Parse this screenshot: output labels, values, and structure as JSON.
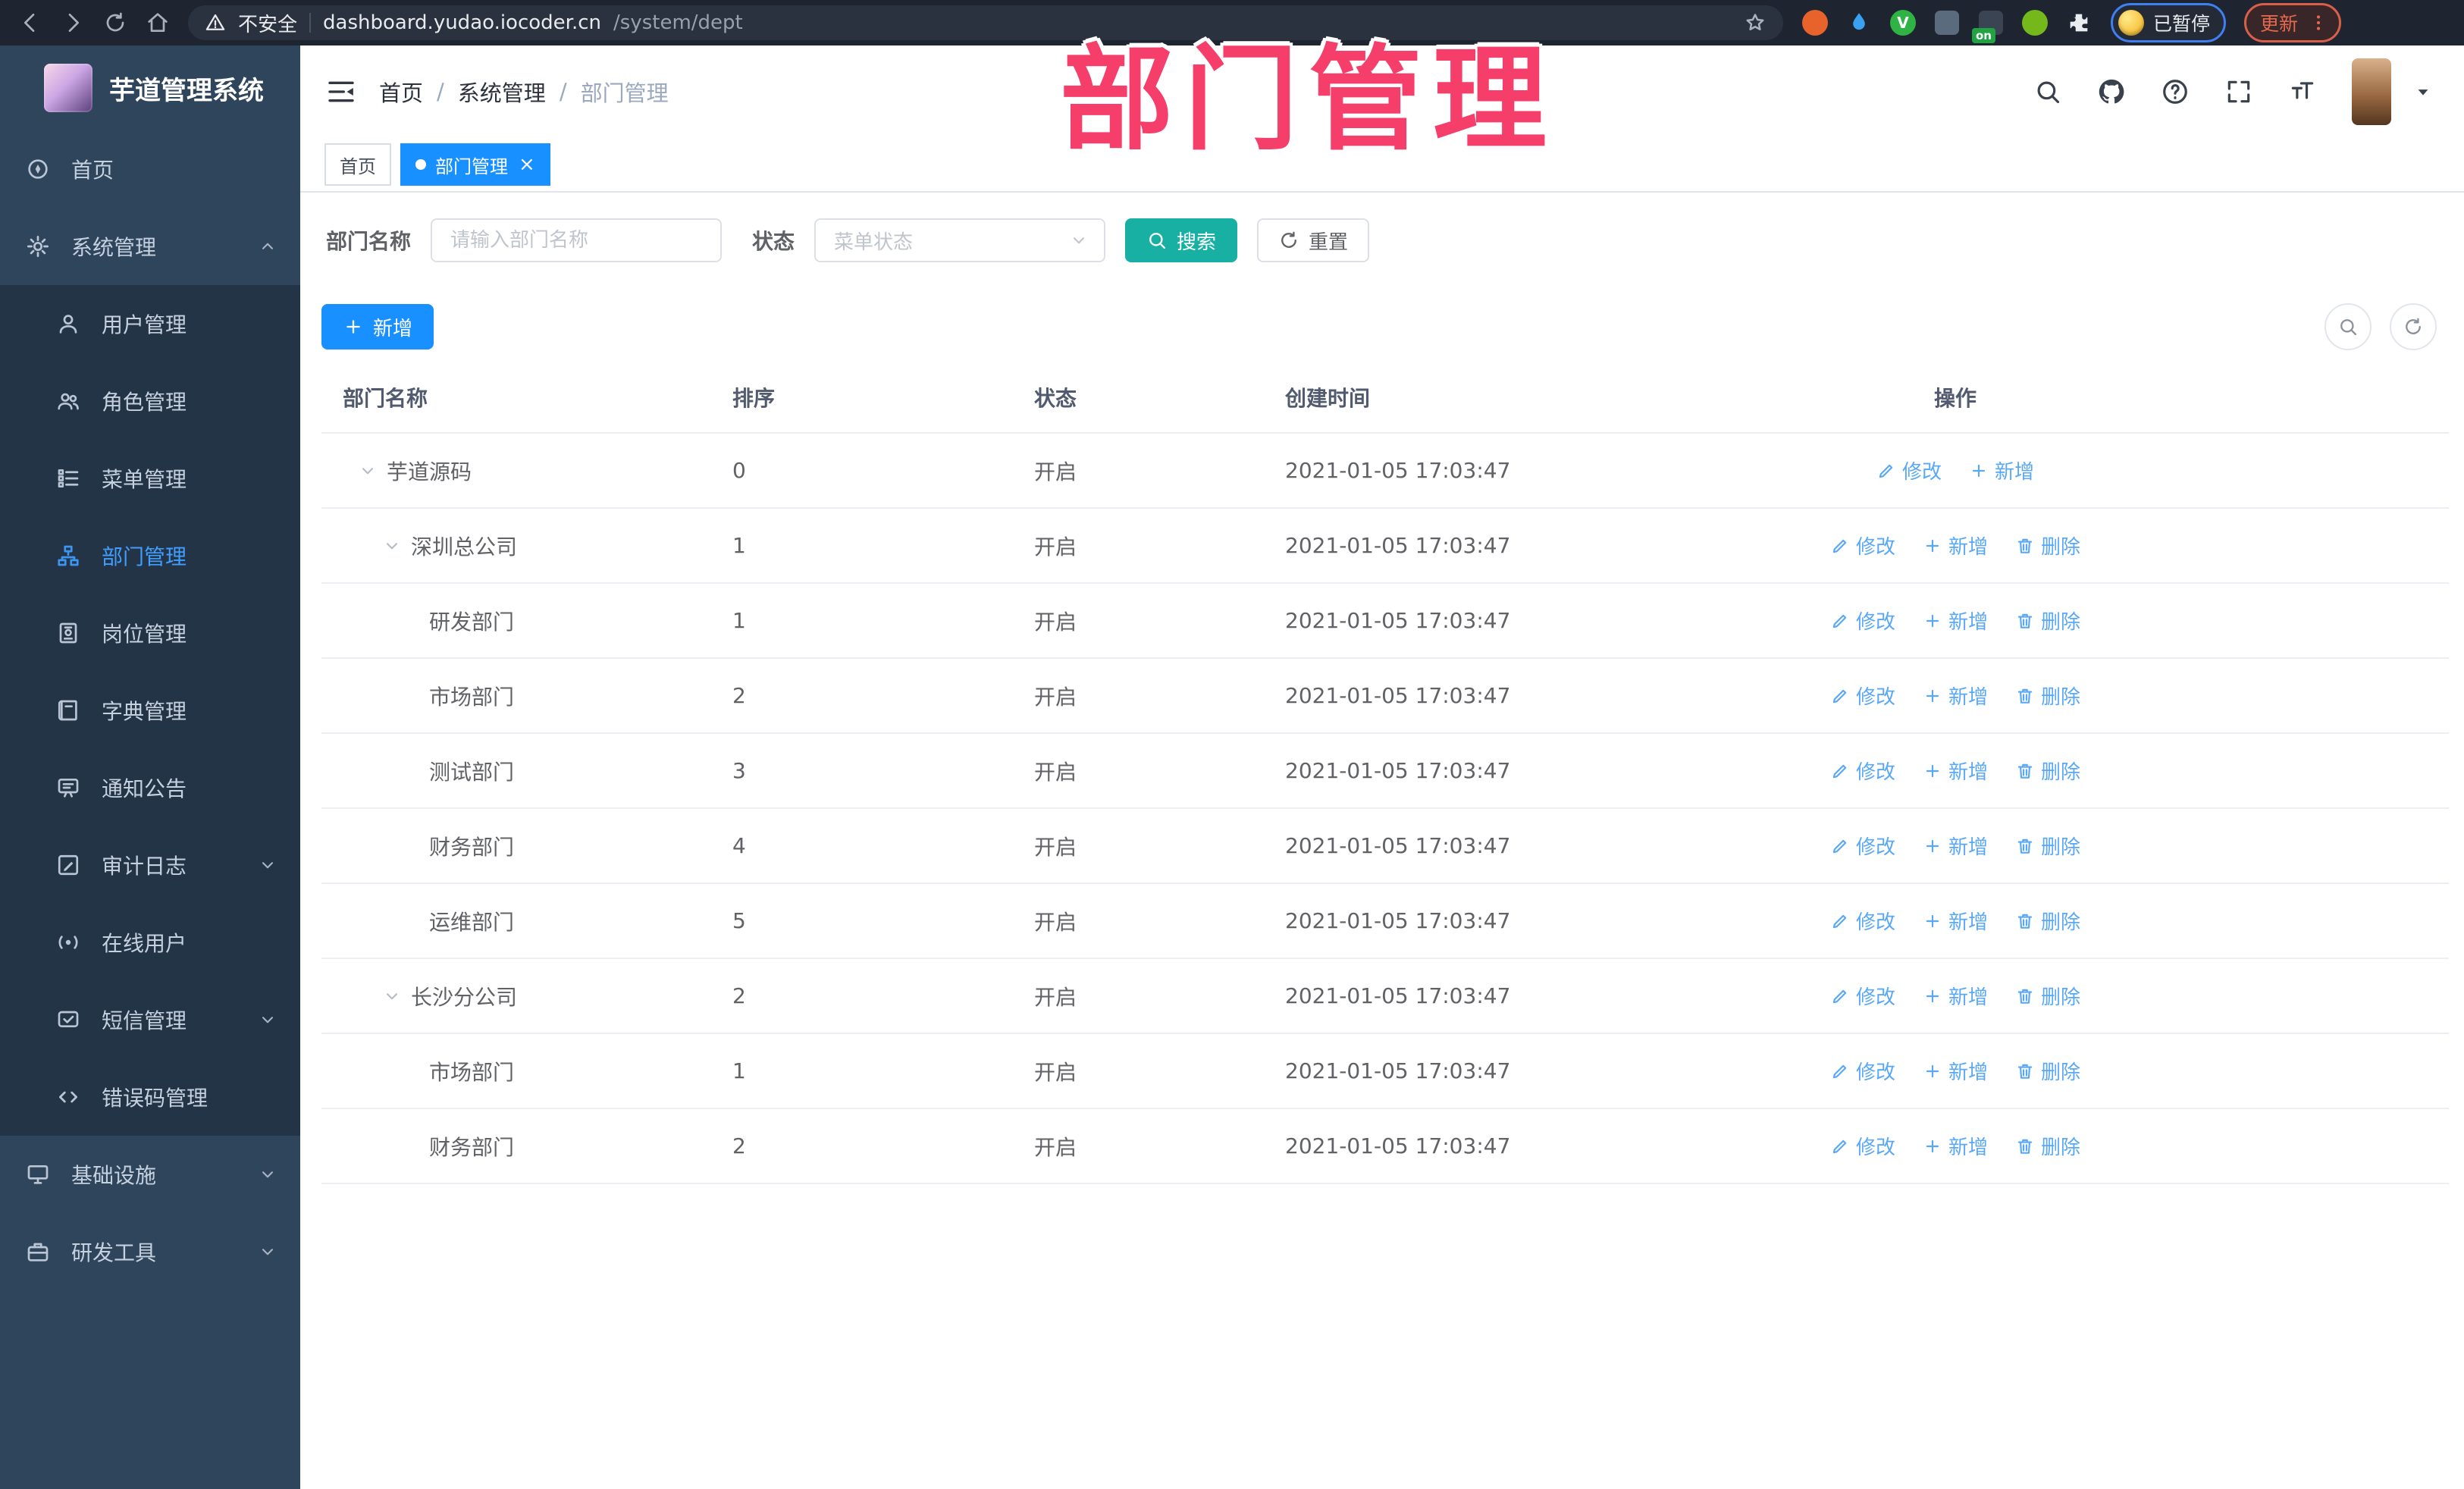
{
  "colors": {
    "accent": "#1890ff",
    "search-btn": "#17b0a3",
    "link": "#59a8f8",
    "sidebar-bg": "#2f455c",
    "submenu-bg": "#233447",
    "sidebar-active": "#409eff",
    "watermark": "#f53e6a",
    "toolbar-bg": "#1e2530"
  },
  "browser": {
    "security_label": "不安全",
    "url_host": "dashboard.yudao.iocoder.cn",
    "url_path": "/system/dept",
    "paused_badge": "已暂停",
    "update_button": "更新",
    "extensions": [
      {
        "key": "orange-ring-extension",
        "shape": "circle",
        "color": "#e8622c"
      },
      {
        "key": "blue-drop-extension",
        "shape": "drop",
        "color": "#3aa0f2"
      },
      {
        "key": "green-v-extension",
        "shape": "circle",
        "color": "#2fb344",
        "glyph": "V"
      },
      {
        "key": "grid-extension",
        "shape": "square",
        "color": "#5a6b7d"
      },
      {
        "key": "stack-extension",
        "shape": "square",
        "color": "#3b4452",
        "badge": "on"
      },
      {
        "key": "green-figure-extension",
        "shape": "circle",
        "color": "#74b81c"
      },
      {
        "key": "puzzle-extension",
        "shape": "puzzle",
        "color": "#e9edf2"
      }
    ]
  },
  "watermark": "部门管理",
  "sidebar": {
    "title": "芋道管理系统",
    "menu": [
      {
        "key": "home",
        "label": "首页",
        "icon": "guide",
        "level": 0
      },
      {
        "key": "system-management",
        "label": "系统管理",
        "icon": "gear",
        "level": 0,
        "chevron": "up"
      },
      {
        "key": "user-management",
        "label": "用户管理",
        "icon": "user",
        "level": 1
      },
      {
        "key": "role-management",
        "label": "角色管理",
        "icon": "users",
        "level": 1
      },
      {
        "key": "menu-management",
        "label": "菜单管理",
        "icon": "menu-list",
        "level": 1
      },
      {
        "key": "dept-management",
        "label": "部门管理",
        "icon": "org-tree",
        "level": 1,
        "active": true
      },
      {
        "key": "post-management",
        "label": "岗位管理",
        "icon": "id-badge",
        "level": 1
      },
      {
        "key": "dict-management",
        "label": "字典管理",
        "icon": "book",
        "level": 1
      },
      {
        "key": "notice-announcement",
        "label": "通知公告",
        "icon": "announce",
        "level": 1
      },
      {
        "key": "audit-log",
        "label": "审计日志",
        "icon": "audit",
        "level": 1,
        "chevron": "down"
      },
      {
        "key": "online-users",
        "label": "在线用户",
        "icon": "online",
        "level": 1
      },
      {
        "key": "sms-management",
        "label": "短信管理",
        "icon": "sms",
        "level": 1,
        "chevron": "down"
      },
      {
        "key": "error-code-management",
        "label": "错误码管理",
        "icon": "code",
        "level": 1
      },
      {
        "key": "infrastructure",
        "label": "基础设施",
        "icon": "monitor",
        "level": 0,
        "chevron": "down"
      },
      {
        "key": "dev-tools",
        "label": "研发工具",
        "icon": "toolbox",
        "level": 0,
        "chevron": "down"
      }
    ]
  },
  "header": {
    "breadcrumb": [
      "首页",
      "系统管理",
      "部门管理"
    ]
  },
  "tabs": [
    {
      "key": "home",
      "label": "首页"
    },
    {
      "key": "dept-management",
      "label": "部门管理",
      "active": true,
      "dot": true,
      "close": "×"
    }
  ],
  "filter": {
    "name_label": "部门名称",
    "name_placeholder": "请输入部门名称",
    "status_label": "状态",
    "status_placeholder": "菜单状态",
    "search_label": "搜索",
    "reset_label": "重置"
  },
  "toolbar": {
    "add_label": "新增"
  },
  "table": {
    "columns": [
      {
        "key": "name",
        "label": "部门名称"
      },
      {
        "key": "sort",
        "label": "排序"
      },
      {
        "key": "status",
        "label": "状态"
      },
      {
        "key": "created",
        "label": "创建时间"
      },
      {
        "key": "actions",
        "label": "操作"
      }
    ],
    "rows": [
      {
        "name": "芋道源码",
        "indent": 0,
        "expand": true,
        "sort": "0",
        "status": "开启",
        "created": "2021-01-05 17:03:47",
        "actions": [
          {
            "label": "修改",
            "icon": "edit"
          },
          {
            "label": "新增",
            "icon": "plus"
          }
        ]
      },
      {
        "name": "深圳总公司",
        "indent": 1,
        "expand": true,
        "sort": "1",
        "status": "开启",
        "created": "2021-01-05 17:03:47",
        "actions": [
          {
            "label": "修改",
            "icon": "edit"
          },
          {
            "label": "新增",
            "icon": "plus"
          },
          {
            "label": "删除",
            "icon": "trash"
          }
        ]
      },
      {
        "name": "研发部门",
        "indent": 2,
        "expand": false,
        "sort": "1",
        "status": "开启",
        "created": "2021-01-05 17:03:47",
        "actions": [
          {
            "label": "修改",
            "icon": "edit"
          },
          {
            "label": "新增",
            "icon": "plus"
          },
          {
            "label": "删除",
            "icon": "trash"
          }
        ]
      },
      {
        "name": "市场部门",
        "indent": 2,
        "expand": false,
        "sort": "2",
        "status": "开启",
        "created": "2021-01-05 17:03:47",
        "actions": [
          {
            "label": "修改",
            "icon": "edit"
          },
          {
            "label": "新增",
            "icon": "plus"
          },
          {
            "label": "删除",
            "icon": "trash"
          }
        ]
      },
      {
        "name": "测试部门",
        "indent": 2,
        "expand": false,
        "sort": "3",
        "status": "开启",
        "created": "2021-01-05 17:03:47",
        "actions": [
          {
            "label": "修改",
            "icon": "edit"
          },
          {
            "label": "新增",
            "icon": "plus"
          },
          {
            "label": "删除",
            "icon": "trash"
          }
        ]
      },
      {
        "name": "财务部门",
        "indent": 2,
        "expand": false,
        "sort": "4",
        "status": "开启",
        "created": "2021-01-05 17:03:47",
        "actions": [
          {
            "label": "修改",
            "icon": "edit"
          },
          {
            "label": "新增",
            "icon": "plus"
          },
          {
            "label": "删除",
            "icon": "trash"
          }
        ]
      },
      {
        "name": "运维部门",
        "indent": 2,
        "expand": false,
        "sort": "5",
        "status": "开启",
        "created": "2021-01-05 17:03:47",
        "actions": [
          {
            "label": "修改",
            "icon": "edit"
          },
          {
            "label": "新增",
            "icon": "plus"
          },
          {
            "label": "删除",
            "icon": "trash"
          }
        ]
      },
      {
        "name": "长沙分公司",
        "indent": 1,
        "expand": true,
        "sort": "2",
        "status": "开启",
        "created": "2021-01-05 17:03:47",
        "actions": [
          {
            "label": "修改",
            "icon": "edit"
          },
          {
            "label": "新增",
            "icon": "plus"
          },
          {
            "label": "删除",
            "icon": "trash"
          }
        ]
      },
      {
        "name": "市场部门",
        "indent": 2,
        "expand": false,
        "sort": "1",
        "status": "开启",
        "created": "2021-01-05 17:03:47",
        "actions": [
          {
            "label": "修改",
            "icon": "edit"
          },
          {
            "label": "新增",
            "icon": "plus"
          },
          {
            "label": "删除",
            "icon": "trash"
          }
        ]
      },
      {
        "name": "财务部门",
        "indent": 2,
        "expand": false,
        "sort": "2",
        "status": "开启",
        "created": "2021-01-05 17:03:47",
        "actions": [
          {
            "label": "修改",
            "icon": "edit"
          },
          {
            "label": "新增",
            "icon": "plus"
          },
          {
            "label": "删除",
            "icon": "trash"
          }
        ]
      }
    ]
  }
}
